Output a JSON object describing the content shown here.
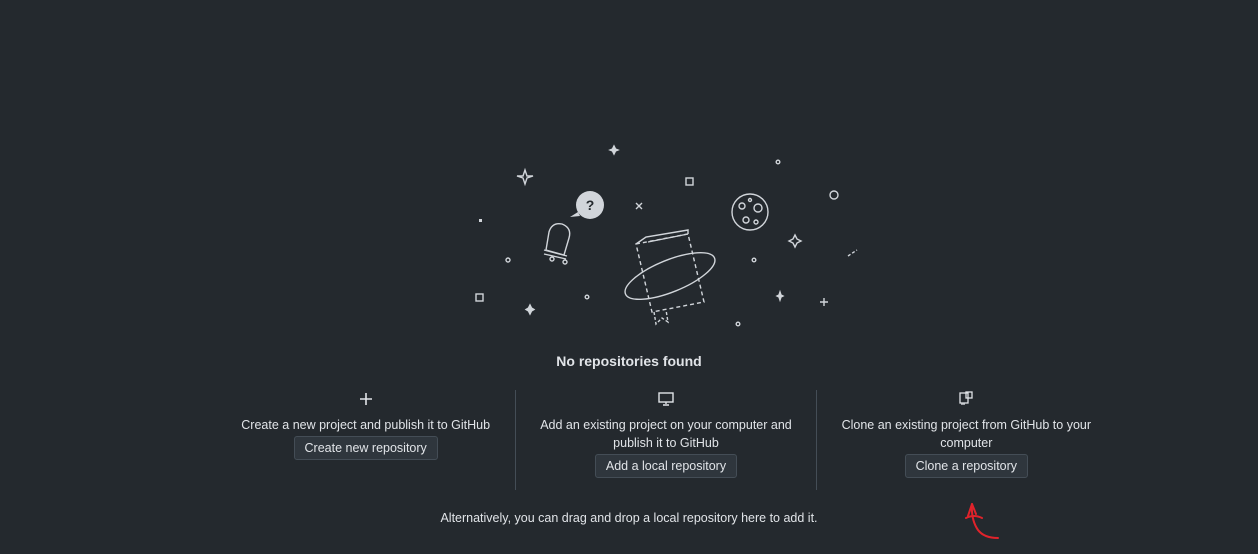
{
  "empty_state": {
    "title": "No repositories found",
    "footer": "Alternatively, you can drag and drop a local repository here to add it."
  },
  "actions": [
    {
      "icon": "plus-icon",
      "description": "Create a new project and publish it to GitHub",
      "button_label": "Create new repository"
    },
    {
      "icon": "desktop-icon",
      "description": "Add an existing project on your computer and publish it to GitHub",
      "button_label": "Add a local repository"
    },
    {
      "icon": "repo-clone-icon",
      "description": "Clone an existing project from GitHub to your computer",
      "button_label": "Clone a repository"
    }
  ],
  "colors": {
    "background": "#24292e",
    "text": "#e1e4e8",
    "button_bg": "#2f363d",
    "border": "#444d56",
    "annotation": "#e0232b"
  }
}
